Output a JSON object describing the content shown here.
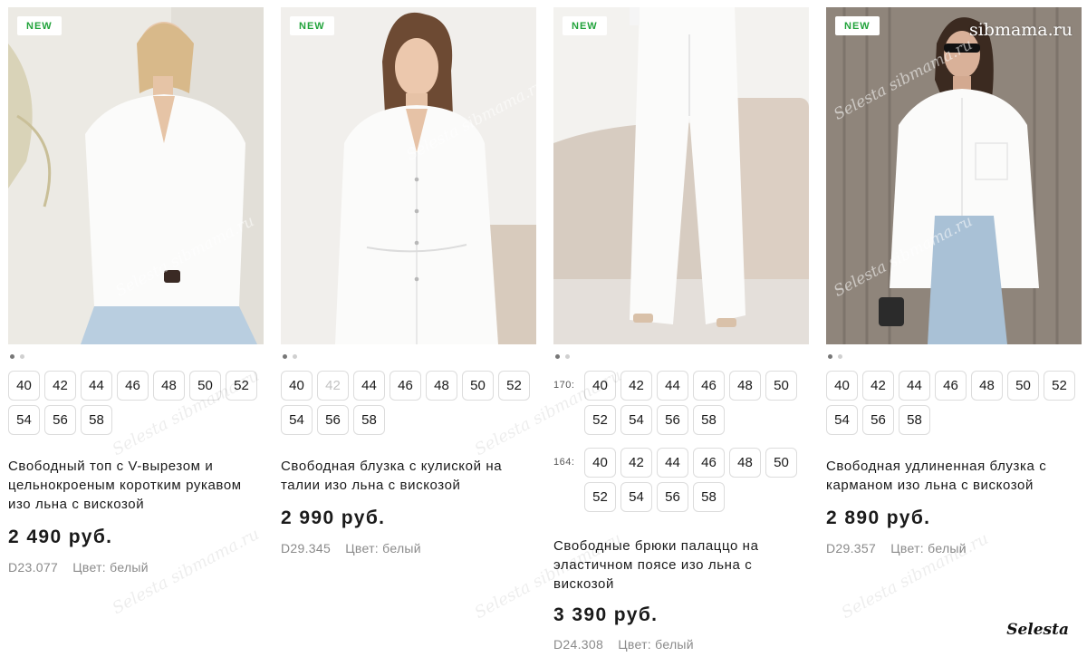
{
  "products": [
    {
      "badge": "NEW",
      "title": "Свободный топ с V-вырезом и цельнокроеным коротким рукавом изо льна с вискозой",
      "price": "2 490 руб.",
      "sku": "D23.077",
      "color": "Цвет: белый",
      "sizes": [
        "40",
        "42",
        "44",
        "46",
        "48",
        "50",
        "52",
        "54",
        "56",
        "58"
      ]
    },
    {
      "badge": "NEW",
      "title": "Свободная блузка с кулиской на талии изо льна с вискозой",
      "price": "2 990 руб.",
      "sku": "D29.345",
      "color": "Цвет: белый",
      "sizes": [
        "40",
        "42",
        "44",
        "46",
        "48",
        "50",
        "52",
        "54",
        "56",
        "58"
      ],
      "unavailable_sizes": [
        "42"
      ]
    },
    {
      "badge": "NEW",
      "title": "Свободные брюки палаццо на эластичном поясе изо льна с вискозой",
      "price": "3 390 руб.",
      "sku": "D24.308",
      "color": "Цвет: белый",
      "height_groups": [
        {
          "label": "170:",
          "sizes": [
            "40",
            "42",
            "44",
            "46",
            "48",
            "50",
            "52",
            "54",
            "56",
            "58"
          ]
        },
        {
          "label": "164:",
          "sizes": [
            "40",
            "42",
            "44",
            "46",
            "48",
            "50",
            "52",
            "54",
            "56",
            "58"
          ]
        }
      ]
    },
    {
      "badge": "NEW",
      "title": "Свободная удлиненная блузка с карманом изо льна с вискозой",
      "price": "2 890 руб.",
      "sku": "D29.357",
      "color": "Цвет: белый",
      "sizes": [
        "40",
        "42",
        "44",
        "46",
        "48",
        "50",
        "52",
        "54",
        "56",
        "58"
      ]
    }
  ],
  "watermarks": {
    "photo": "Selesta sibmama.ru",
    "corner": "sibmama.ru",
    "logo": "Selesta"
  },
  "colors": {
    "badge_text": "#21a33b",
    "price": "#1a1a1a",
    "meta": "#8a8a8a"
  }
}
